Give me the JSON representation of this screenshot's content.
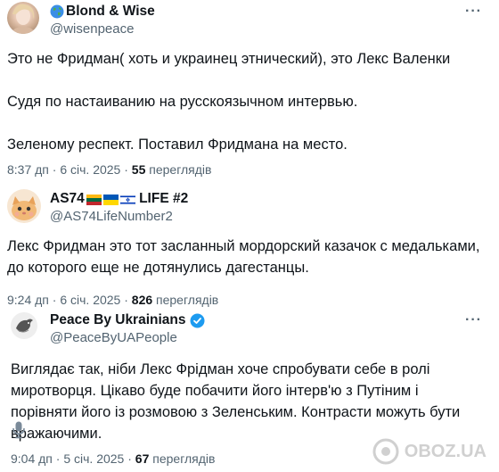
{
  "tweets": [
    {
      "name": "Blond & Wise",
      "handle": "@wisenpeace",
      "text": "Это не Фридман( хоть и украинец этнический), это Лекс Валенки\n\nСудя по настаиванию на русскоязычном интервью.\n\nЗеленому респект. Поставил Фридмана на место.",
      "time": "8:37 дп · 6 січ. 2025 · ",
      "views_count": "55",
      "views_label": " переглядів"
    },
    {
      "name_prefix": "AS74",
      "name_suffix": " LIFE #2",
      "handle": "@AS74LifeNumber2",
      "text": "Лекс Фридман это тот засланный мордорский казачок с медальками, до которого еще не дотянулись дагестанцы.",
      "time": "9:24 дп · 6 січ. 2025 · ",
      "views_count": "826",
      "views_label": " переглядів"
    },
    {
      "name": "Peace By Ukrainians",
      "handle": "@PeaceByUAPeople",
      "text": "Виглядає так, ніби Лекс Фрідман хоче спробувати себе в ролі миротворця. Цікаво буде побачити його інтерв'ю з Путіним і порівняти його із розмовою з Зеленським. Контрасти можуть бути вражаючими.",
      "time": "9:04 дп · 5 січ. 2025 · ",
      "views_count": "67",
      "views_label": " переглядів"
    }
  ],
  "more_label": "···",
  "watermark": "OBOZ.UA",
  "colors": {
    "text": "#0f1419",
    "secondary": "#536471",
    "verified": "#1d9bf0"
  },
  "icons": [
    "globe-icon",
    "lithuania-flag-icon",
    "ukraine-flag-icon",
    "israel-flag-icon",
    "verified-badge-icon",
    "microphone-icon",
    "more-icon"
  ]
}
